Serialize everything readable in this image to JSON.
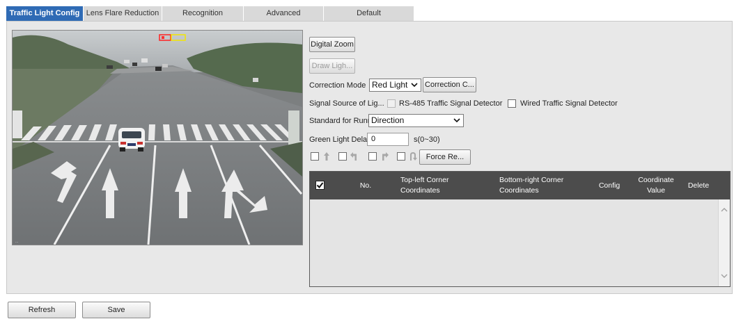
{
  "tabs": [
    {
      "label": "Traffic Light Config",
      "active": true
    },
    {
      "label": "Lens Flare Reduction",
      "active": false
    },
    {
      "label": "Recognition",
      "active": false
    },
    {
      "label": "Advanced",
      "active": false
    },
    {
      "label": "Default",
      "active": false
    }
  ],
  "controls": {
    "digital_zoom": "Digital Zoom",
    "draw_light": "Draw Ligh...",
    "correction_mode_label": "Correction Mode",
    "correction_mode_value": "Red Light",
    "correction_button": "Correction C...",
    "signal_source_label": "Signal Source of Lig...",
    "rs485_label": "RS-485 Traffic Signal Detector",
    "wired_label": "Wired Traffic Signal Detector",
    "standard_label": "Standard for Runnin...",
    "standard_value": "Direction",
    "green_delay_label": "Green Light Delay",
    "green_delay_value": "0",
    "green_delay_unit": "s(0~30)",
    "force_button": "Force Re..."
  },
  "direction_icons": [
    "arrow-straight-icon",
    "arrow-left-icon",
    "arrow-right-icon",
    "arrow-uturn-icon"
  ],
  "table": {
    "columns": [
      "No.",
      "Top-left Corner Coordinates",
      "Bottom-right Corner Coordinates",
      "Config",
      "Coordinate Value",
      "Delete"
    ],
    "header_checked": true,
    "rows": []
  },
  "footer": {
    "refresh": "Refresh",
    "save": "Save"
  },
  "colors": {
    "tab_active": "#2f6bb5",
    "tab_inactive": "#d9d9d9",
    "table_header": "#4c4c4c",
    "panel_bg": "#e8e8e8"
  }
}
